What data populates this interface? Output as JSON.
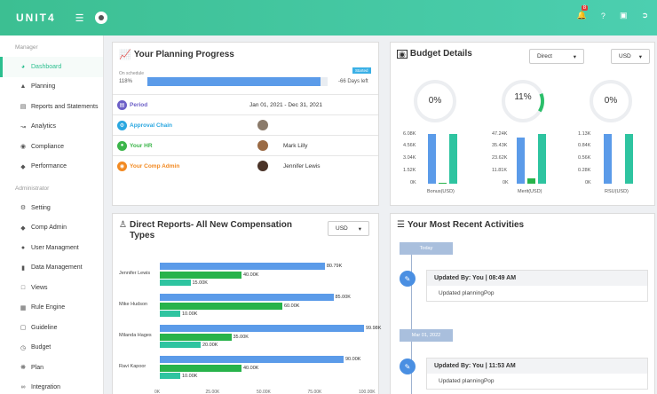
{
  "topbar": {
    "logo": "UNIT4",
    "badge": "8",
    "menu_icon": "hamburger-icon"
  },
  "sidebar": {
    "manager_title": "Manager",
    "manager_items": [
      {
        "label": "Dashboard",
        "icon": "speedometer-icon",
        "active": true
      },
      {
        "label": "Planning",
        "icon": "sitemap-icon"
      },
      {
        "label": "Reports and Statements",
        "icon": "bar-chart-icon"
      },
      {
        "label": "Analytics",
        "icon": "line-chart-icon"
      },
      {
        "label": "Compliance",
        "icon": "eye-icon"
      },
      {
        "label": "Performance",
        "icon": "graduation-cap-icon"
      }
    ],
    "admin_title": "Administrator",
    "admin_items": [
      {
        "label": "Setting",
        "icon": "gear-icon"
      },
      {
        "label": "Comp Admin",
        "icon": "graduation-cap-icon"
      },
      {
        "label": "User Managment",
        "icon": "user-icon"
      },
      {
        "label": "Data Management",
        "icon": "book-icon"
      },
      {
        "label": "Views",
        "icon": "folder-icon"
      },
      {
        "label": "Rule Engine",
        "icon": "table-icon"
      },
      {
        "label": "Guideline",
        "icon": "square-icon"
      },
      {
        "label": "Budget",
        "icon": "clock-icon"
      },
      {
        "label": "Plan",
        "icon": "settings-icon"
      },
      {
        "label": "Integration",
        "icon": "link-icon"
      }
    ]
  },
  "planning": {
    "title": "Your Planning Progress",
    "on_schedule": "On schedule",
    "started": "Started",
    "percent": "118%",
    "progress": 0.96,
    "days_left": "-66 Days left",
    "rows": [
      {
        "label": "Period",
        "value": "Jan 01, 2021 - Dec 31, 2021",
        "color": "#6c5fc7"
      },
      {
        "label": "Approval Chain",
        "value": "",
        "color": "#2aa7e0"
      },
      {
        "label": "Your HR",
        "value": "Mark Lilly",
        "color": "#3bb54a"
      },
      {
        "label": "Your Comp Admin",
        "value": "Jennifer Lewis",
        "color": "#f28a22"
      }
    ]
  },
  "budget": {
    "title": "Budget Details",
    "select1": "Direct",
    "select2": "USD",
    "donuts": [
      "0%",
      "11%",
      "0%"
    ],
    "charts": [
      {
        "ticks": [
          "6.08K",
          "4.56K",
          "3.04K",
          "1.52K",
          "0K"
        ],
        "label": "Bonus(USD)",
        "values": [
          1.0,
          0.015,
          1.0
        ]
      },
      {
        "ticks": [
          "47.24K",
          "35.43K",
          "23.62K",
          "11.81K",
          "0K"
        ],
        "label": "Merit(USD)",
        "values": [
          0.93,
          0.11,
          1.0
        ]
      },
      {
        "ticks": [
          "1.13K",
          "0.84K",
          "0.56K",
          "0.28K",
          "0K"
        ],
        "label": "RSU(USD)",
        "values": [
          1.0,
          0.0,
          1.0
        ]
      }
    ]
  },
  "reports": {
    "title": "Direct Reports- All New Compensation Types",
    "select": "USD"
  },
  "chart_data": {
    "type": "bar",
    "orientation": "horizontal",
    "categories": [
      "Jennifer Lewis",
      "Mike Hudson",
      "Milanda Hages",
      "Ravi Kapoor"
    ],
    "series": [
      {
        "values": [
          80.79,
          85.0,
          99.98,
          90.0
        ],
        "labels": [
          "80.79K",
          "85.00K",
          "99.98K",
          "90.00K"
        ],
        "color": "#5b9be9"
      },
      {
        "values": [
          40.0,
          60.0,
          35.0,
          40.0
        ],
        "labels": [
          "40.00K",
          "60.00K",
          "35.00K",
          "40.00K"
        ],
        "color": "#28b34b"
      },
      {
        "values": [
          15.0,
          10.0,
          20.0,
          10.0
        ],
        "labels": [
          "15.00K",
          "10.00K",
          "20.00K",
          "10.00K"
        ],
        "color": "#2ec4a0"
      }
    ],
    "xticks": [
      "0K",
      "25.00K",
      "50.00K",
      "75.00K",
      "100.00K"
    ],
    "xlim": [
      0,
      100
    ]
  },
  "activities": {
    "title": "Your Most Recent Activities",
    "today": "Today",
    "date2": "Mar 01, 2022",
    "items": [
      {
        "head": "Updated By: You | 08:49 AM",
        "body": "Updated planningPop"
      },
      {
        "head": "Updated By: You | 11:53 AM",
        "body": "Updated planningPop"
      }
    ]
  }
}
